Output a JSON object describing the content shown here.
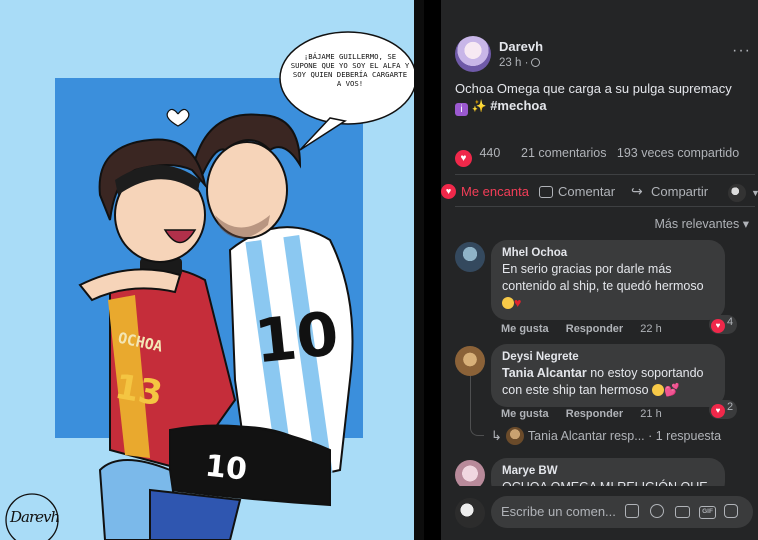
{
  "artwork": {
    "speech_bubble": "¡BÁJAME GUILLERMO, SE SUPONE QUE YO SOY EL ALFA Y SOY QUIEN DEBERÍA CARGARTE A VOS!",
    "jersey_left_text": "OCHOA",
    "jersey_left_number": "13",
    "jersey_right_number": "10",
    "signature": "Darevh"
  },
  "post": {
    "author": "Darevh",
    "time": "23 h ·",
    "text": "Ochoa Omega que carga a su pulga supremacy",
    "emoji_1": "i",
    "emoji_2": "✨",
    "hashtag": "#mechoa",
    "reactions_count": "440",
    "comments_count": "21 comentarios",
    "shares_count": "193 veces compartido",
    "more_icon": "···"
  },
  "actions": {
    "love": "Me encanta",
    "comment": "Comentar",
    "share": "Compartir"
  },
  "sort": {
    "label": "Más relevantes ▾"
  },
  "comments": [
    {
      "name": "Mhel Ochoa",
      "text": "En serio gracias por darle más contenido al ship, te quedó hermoso",
      "like": "Me gusta",
      "reply": "Responder",
      "time": "22 h",
      "reacts": "4"
    },
    {
      "name": "Deysi Negrete",
      "mention": "Tania Alcantar",
      "text": " no estoy soportando con este ship tan hermoso",
      "like": "Me gusta",
      "reply": "Responder",
      "time": "21 h",
      "reacts": "2"
    },
    {
      "name": "Marye BW",
      "text": "OCHOA OMEGA MI RELIGIÓN QUE"
    }
  ],
  "replies": {
    "label": "Tania Alcantar resp... · 1 respuesta"
  },
  "composer": {
    "placeholder": "Escribe un comen..."
  }
}
